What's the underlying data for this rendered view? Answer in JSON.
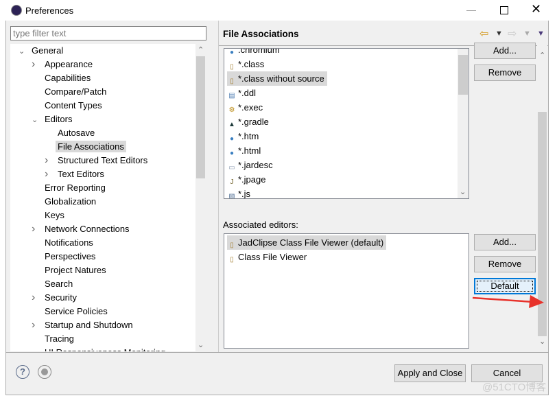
{
  "window": {
    "title": "Preferences"
  },
  "filter": {
    "placeholder": "type filter text"
  },
  "tree": [
    {
      "label": "General",
      "level": 0,
      "expander": "open"
    },
    {
      "label": "Appearance",
      "level": 1,
      "expander": "closed"
    },
    {
      "label": "Capabilities",
      "level": 1,
      "expander": "none"
    },
    {
      "label": "Compare/Patch",
      "level": 1,
      "expander": "none"
    },
    {
      "label": "Content Types",
      "level": 1,
      "expander": "none"
    },
    {
      "label": "Editors",
      "level": 1,
      "expander": "open"
    },
    {
      "label": "Autosave",
      "level": 2,
      "expander": "none"
    },
    {
      "label": "File Associations",
      "level": 2,
      "expander": "none",
      "selected": true
    },
    {
      "label": "Structured Text Editors",
      "level": 2,
      "expander": "closed"
    },
    {
      "label": "Text Editors",
      "level": 2,
      "expander": "closed"
    },
    {
      "label": "Error Reporting",
      "level": 1,
      "expander": "none"
    },
    {
      "label": "Globalization",
      "level": 1,
      "expander": "none"
    },
    {
      "label": "Keys",
      "level": 1,
      "expander": "none"
    },
    {
      "label": "Network Connections",
      "level": 1,
      "expander": "closed"
    },
    {
      "label": "Notifications",
      "level": 1,
      "expander": "none"
    },
    {
      "label": "Perspectives",
      "level": 1,
      "expander": "none"
    },
    {
      "label": "Project Natures",
      "level": 1,
      "expander": "none"
    },
    {
      "label": "Search",
      "level": 1,
      "expander": "none"
    },
    {
      "label": "Security",
      "level": 1,
      "expander": "closed"
    },
    {
      "label": "Service Policies",
      "level": 1,
      "expander": "none"
    },
    {
      "label": "Startup and Shutdown",
      "level": 1,
      "expander": "closed"
    },
    {
      "label": "Tracing",
      "level": 1,
      "expander": "none"
    },
    {
      "label": "UI Responsiveness Monitoring",
      "level": 1,
      "expander": "none"
    }
  ],
  "page": {
    "title": "File Associations",
    "associated_editors_label": "Associated editors:"
  },
  "file_types": [
    {
      "label": ".chromium",
      "icon": "globe-icon"
    },
    {
      "label": "*.class",
      "icon": "class-file-icon"
    },
    {
      "label": "*.class without source",
      "icon": "class-file-icon",
      "selected": true
    },
    {
      "label": "*.ddl",
      "icon": "ddl-file-icon"
    },
    {
      "label": "*.exec",
      "icon": "gears-icon"
    },
    {
      "label": "*.gradle",
      "icon": "gradle-elephant-icon"
    },
    {
      "label": "*.htm",
      "icon": "globe-icon"
    },
    {
      "label": "*.html",
      "icon": "globe-icon"
    },
    {
      "label": "*.jardesc",
      "icon": "jar-icon"
    },
    {
      "label": "*.jpage",
      "icon": "java-page-icon"
    },
    {
      "label": "*.js",
      "icon": "js-file-icon"
    }
  ],
  "editors": [
    {
      "label": "JadClipse Class File Viewer (default)",
      "icon": "class-file-icon",
      "selected": true
    },
    {
      "label": "Class File Viewer",
      "icon": "class-file-icon"
    }
  ],
  "buttons": {
    "add_types": "Add...",
    "remove_types": "Remove",
    "add_editor": "Add...",
    "remove_editor": "Remove",
    "default": "Default",
    "apply_close": "Apply and Close",
    "cancel": "Cancel"
  },
  "watermark": "@51CTO博客",
  "colors": {
    "arrow": "#e8322b",
    "focus": "#0078d7",
    "selection": "#d9d9d9"
  }
}
